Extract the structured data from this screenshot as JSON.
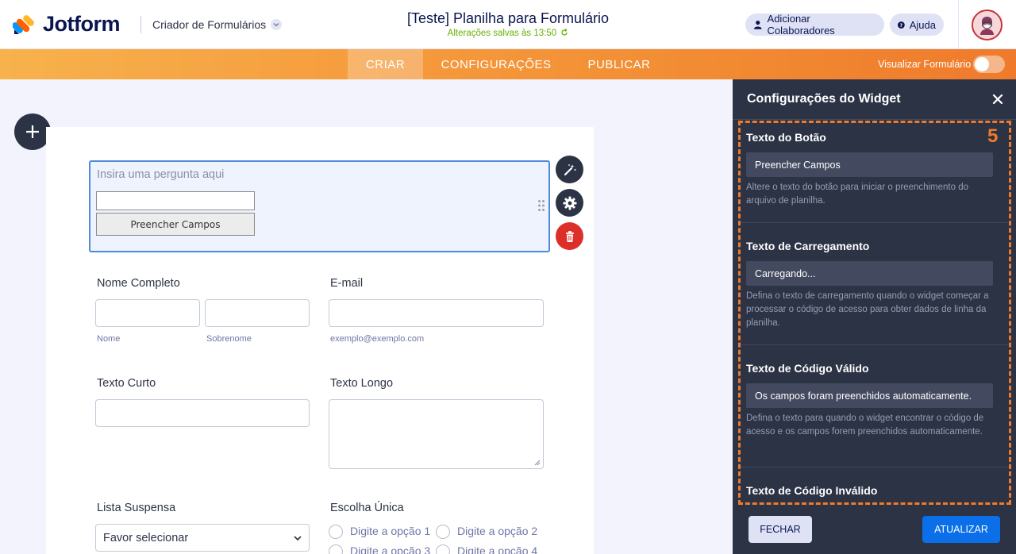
{
  "header": {
    "logo_text": "Jotform",
    "builder_label": "Criador de Formulários",
    "form_title": "[Teste] Planilha para Formulário",
    "saved_status": "Alterações salvas às 13:50",
    "collab_label": "Adicionar Colaboradores",
    "help_label": "Ajuda"
  },
  "nav": {
    "tabs": [
      {
        "label": "CRIAR",
        "active": true
      },
      {
        "label": "CONFIGURAÇÕES",
        "active": false
      },
      {
        "label": "PUBLICAR",
        "active": false
      }
    ],
    "preview_label": "Visualizar Formulário"
  },
  "form": {
    "widget": {
      "question_placeholder": "Insira uma pergunta aqui",
      "button_label": "Preencher Campos"
    },
    "full_name": {
      "label": "Nome Completo",
      "first_sub": "Nome",
      "last_sub": "Sobrenome"
    },
    "email": {
      "label": "E-mail",
      "sub": "exemplo@exemplo.com"
    },
    "short_text": {
      "label": "Texto Curto"
    },
    "long_text": {
      "label": "Texto Longo"
    },
    "dropdown": {
      "label": "Lista Suspensa",
      "value": "Favor selecionar"
    },
    "single_choice": {
      "label": "Escolha Única",
      "options": [
        "Digite a opção 1",
        "Digite a opção 2",
        "Digite a opção 3",
        "Digite a opção 4"
      ]
    }
  },
  "panel": {
    "title": "Configurações do Widget",
    "step_number": "5",
    "props": [
      {
        "label": "Texto do Botão",
        "value": "Preencher Campos",
        "desc": "Altere o texto do botão para iniciar o preenchimento do arquivo de planilha."
      },
      {
        "label": "Texto de Carregamento",
        "value": "Carregando...",
        "desc": "Defina o texto de carregamento quando o widget começar a processar o código de acesso para obter dados de linha da planilha."
      },
      {
        "label": "Texto de Código Válido",
        "value": "Os campos foram preenchidos automaticamente.",
        "desc": "Defina o texto para quando o widget encontrar o código de acesso e os campos forem preenchidos automaticamente."
      },
      {
        "label": "Texto de Código Inválido"
      }
    ],
    "close_label": "FECHAR",
    "update_label": "ATUALIZAR"
  },
  "colors": {
    "accent_orange": "#f07a2b",
    "navy": "#0a1551",
    "panel_bg": "#2c3345",
    "primary_blue": "#0a6fe8",
    "danger_red": "#dc2f2a",
    "saved_green": "#64b200"
  },
  "icons": [
    "jotform-logo-icon",
    "chevron-down-icon",
    "user-icon",
    "help-icon",
    "avatar-icon",
    "plus-icon",
    "magic-wand-icon",
    "gear-icon",
    "trash-icon",
    "drag-handle-icon",
    "close-icon",
    "refresh-icon"
  ]
}
